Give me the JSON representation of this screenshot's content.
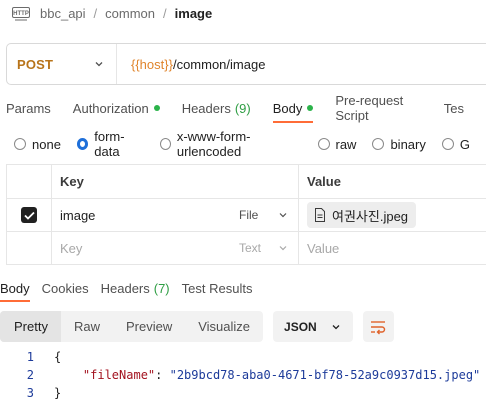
{
  "breadcrumb": {
    "icon": "http-icon",
    "items": [
      "bbc_api",
      "common"
    ],
    "separator": "/",
    "current": "image"
  },
  "request": {
    "method": "POST",
    "url_var": "{{host}}",
    "url_path": "/common/image"
  },
  "request_tabs": [
    {
      "label": "Params"
    },
    {
      "label": "Authorization",
      "dot": true
    },
    {
      "label": "Headers",
      "count": "(9)"
    },
    {
      "label": "Body",
      "dot": true,
      "active": true
    },
    {
      "label": "Pre-request Script"
    },
    {
      "label": "Tes"
    }
  ],
  "body_types": [
    {
      "label": "none",
      "checked": false
    },
    {
      "label": "form-data",
      "checked": true
    },
    {
      "label": "x-www-form-urlencoded",
      "checked": false
    },
    {
      "label": "raw",
      "checked": false
    },
    {
      "label": "binary",
      "checked": false
    },
    {
      "label": "G",
      "checked": false
    }
  ],
  "form_table": {
    "header_key": "Key",
    "header_value": "Value",
    "rows": [
      {
        "key": "image",
        "type": "File",
        "value": "여권사진.jpeg",
        "checked": true
      }
    ],
    "placeholder": {
      "key": "Key",
      "type": "Text",
      "value": "Value"
    }
  },
  "response_tabs": [
    {
      "label": "Body",
      "active": true
    },
    {
      "label": "Cookies"
    },
    {
      "label": "Headers",
      "count": "(7)"
    },
    {
      "label": "Test Results"
    }
  ],
  "view_modes": [
    {
      "label": "Pretty",
      "active": true
    },
    {
      "label": "Raw"
    },
    {
      "label": "Preview"
    },
    {
      "label": "Visualize"
    }
  ],
  "format": "JSON",
  "response_json": {
    "lines": [
      "1",
      "2",
      "3"
    ],
    "open_brace": "{",
    "key": "\"fileName\"",
    "colon": ": ",
    "value": "\"2b9bcd78-aba0-4671-bf78-52a9c0937d15.jpeg\"",
    "close_brace": "}"
  },
  "colors": {
    "method_post": "#b8741a",
    "variable": "#e0852d",
    "active_tab_underline": "#ff6c37",
    "status_dot": "#2bb34a",
    "radio_checked": "#1e6fd9",
    "json_key": "#a3121f",
    "json_string": "#1d3b9a"
  }
}
